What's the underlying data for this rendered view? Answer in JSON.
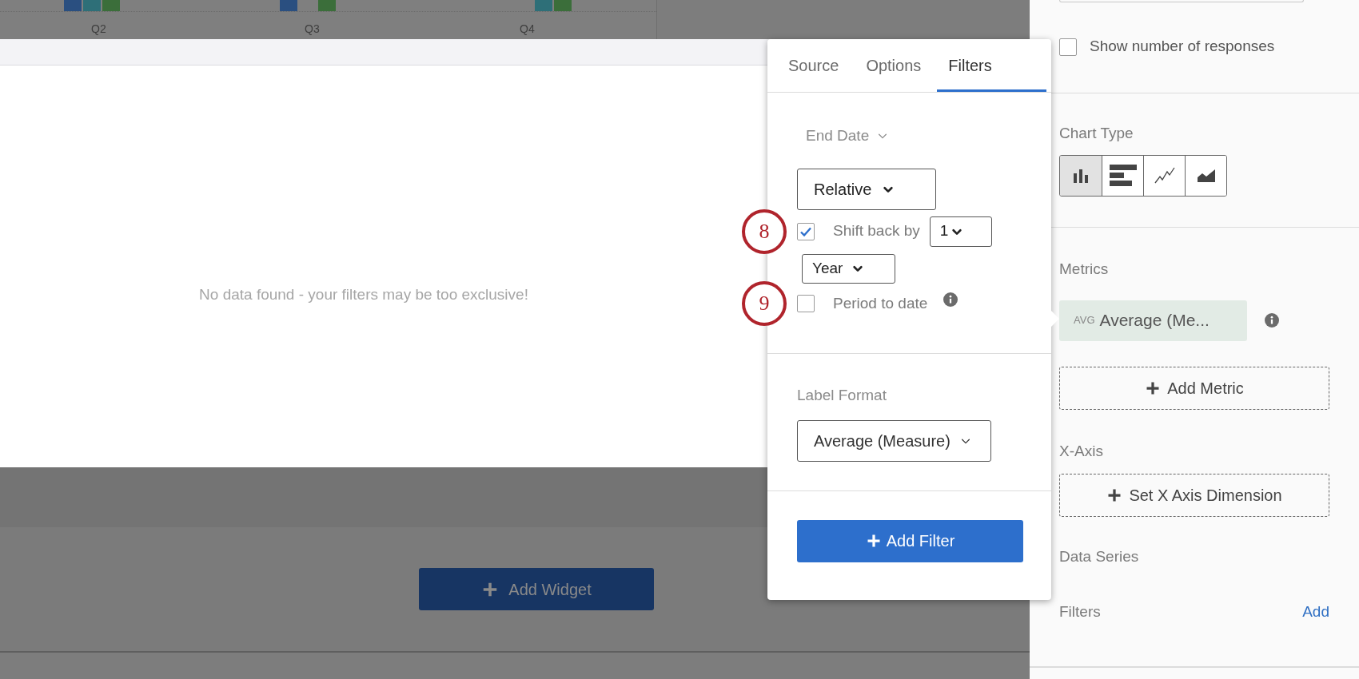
{
  "background_chart": {
    "axis_labels": [
      "Q2",
      "Q3",
      "Q4"
    ]
  },
  "widget": {
    "empty_message": "No data found - your filters may be too exclusive!"
  },
  "add_widget_button": {
    "label": "Add Widget"
  },
  "popup": {
    "tabs": [
      {
        "label": "Source",
        "selected": false
      },
      {
        "label": "Options",
        "selected": false
      },
      {
        "label": "Filters",
        "selected": true
      }
    ],
    "field": {
      "label": "End Date"
    },
    "date_mode": {
      "value": "Relative"
    },
    "shift_back": {
      "checked": true,
      "label": "Shift back by",
      "amount": "1",
      "unit": "Year",
      "callout": "8"
    },
    "period_to_date": {
      "checked": false,
      "label": "Period to date",
      "callout": "9"
    },
    "label_format": {
      "label": "Label Format",
      "value": "Average (Measure)"
    },
    "add_filter_button": {
      "label": "Add Filter"
    }
  },
  "side_panel": {
    "show_responses": {
      "checked": false,
      "label": "Show number of responses"
    },
    "chart_type": {
      "label": "Chart Type",
      "options": [
        {
          "kind": "bar",
          "selected": true
        },
        {
          "kind": "horizontal-bar",
          "selected": false
        },
        {
          "kind": "line",
          "selected": false
        },
        {
          "kind": "area",
          "selected": false
        }
      ]
    },
    "metrics": {
      "label": "Metrics",
      "chip": {
        "tag": "AVG",
        "label": "Average (Me..."
      },
      "add_button": "Add Metric"
    },
    "x_axis": {
      "label": "X-Axis",
      "add_button": "Set X Axis Dimension"
    },
    "data_series": {
      "label": "Data Series"
    },
    "filters": {
      "label": "Filters",
      "action": "Add"
    }
  }
}
